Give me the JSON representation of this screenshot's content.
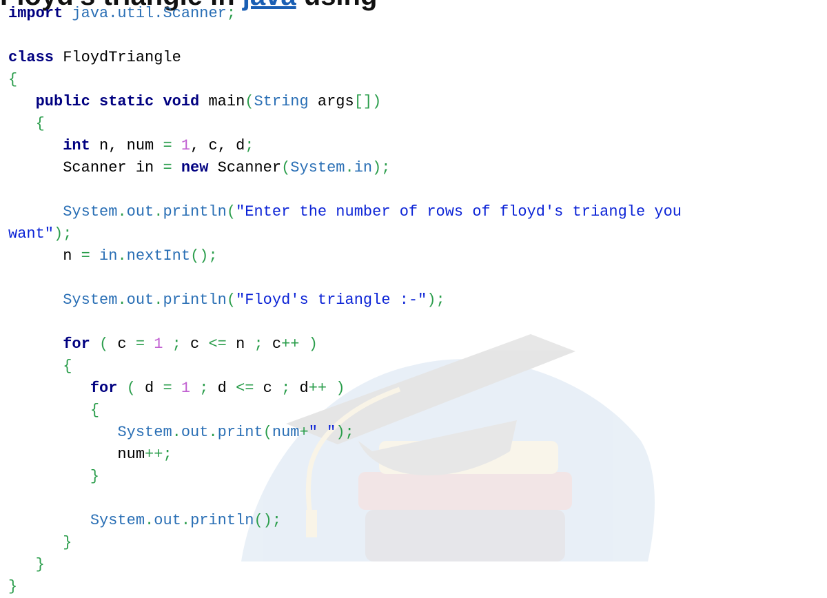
{
  "title_fragment": {
    "left_text": "Floyd's triangle in ",
    "link_text": "java",
    "right_text": " using"
  },
  "code_lines": [
    [
      {
        "t": "import",
        "c": "kw"
      },
      {
        "t": " ",
        "c": "id"
      },
      {
        "t": "java.util.Scanner",
        "c": "pk"
      },
      {
        "t": ";",
        "c": "op"
      }
    ],
    [],
    [
      {
        "t": "class",
        "c": "kw"
      },
      {
        "t": " FloydTriangle",
        "c": "id"
      }
    ],
    [
      {
        "t": "{",
        "c": "op"
      }
    ],
    [
      {
        "t": "   ",
        "c": "id"
      },
      {
        "t": "public",
        "c": "kw"
      },
      {
        "t": " ",
        "c": "id"
      },
      {
        "t": "static",
        "c": "kw"
      },
      {
        "t": " ",
        "c": "id"
      },
      {
        "t": "void",
        "c": "kw"
      },
      {
        "t": " main",
        "c": "id"
      },
      {
        "t": "(",
        "c": "op"
      },
      {
        "t": "String",
        "c": "pk"
      },
      {
        "t": " args",
        "c": "id"
      },
      {
        "t": "[])",
        "c": "op"
      }
    ],
    [
      {
        "t": "   ",
        "c": "id"
      },
      {
        "t": "{",
        "c": "op"
      }
    ],
    [
      {
        "t": "      ",
        "c": "id"
      },
      {
        "t": "int",
        "c": "kw"
      },
      {
        "t": " n, num ",
        "c": "id"
      },
      {
        "t": "=",
        "c": "op"
      },
      {
        "t": " ",
        "c": "id"
      },
      {
        "t": "1",
        "c": "num"
      },
      {
        "t": ", c, d",
        "c": "id"
      },
      {
        "t": ";",
        "c": "op"
      }
    ],
    [
      {
        "t": "      Scanner in ",
        "c": "id"
      },
      {
        "t": "=",
        "c": "op"
      },
      {
        "t": " ",
        "c": "id"
      },
      {
        "t": "new",
        "c": "kw"
      },
      {
        "t": " Scanner",
        "c": "id"
      },
      {
        "t": "(",
        "c": "op"
      },
      {
        "t": "System",
        "c": "fn"
      },
      {
        "t": ".",
        "c": "op"
      },
      {
        "t": "in",
        "c": "fn"
      },
      {
        "t": ");",
        "c": "op"
      }
    ],
    [],
    [
      {
        "t": "      ",
        "c": "id"
      },
      {
        "t": "System",
        "c": "fn"
      },
      {
        "t": ".",
        "c": "op"
      },
      {
        "t": "out",
        "c": "fn"
      },
      {
        "t": ".",
        "c": "op"
      },
      {
        "t": "println",
        "c": "fn"
      },
      {
        "t": "(",
        "c": "op"
      },
      {
        "t": "\"Enter the number of rows of floyd's triangle you",
        "c": "str"
      }
    ],
    [
      {
        "t": "want\"",
        "c": "str"
      },
      {
        "t": ");",
        "c": "op"
      }
    ],
    [
      {
        "t": "      n ",
        "c": "id"
      },
      {
        "t": "=",
        "c": "op"
      },
      {
        "t": " ",
        "c": "id"
      },
      {
        "t": "in",
        "c": "fn"
      },
      {
        "t": ".",
        "c": "op"
      },
      {
        "t": "nextInt",
        "c": "fn"
      },
      {
        "t": "();",
        "c": "op"
      }
    ],
    [],
    [
      {
        "t": "      ",
        "c": "id"
      },
      {
        "t": "System",
        "c": "fn"
      },
      {
        "t": ".",
        "c": "op"
      },
      {
        "t": "out",
        "c": "fn"
      },
      {
        "t": ".",
        "c": "op"
      },
      {
        "t": "println",
        "c": "fn"
      },
      {
        "t": "(",
        "c": "op"
      },
      {
        "t": "\"Floyd's triangle :-\"",
        "c": "str"
      },
      {
        "t": ");",
        "c": "op"
      }
    ],
    [],
    [
      {
        "t": "      ",
        "c": "id"
      },
      {
        "t": "for",
        "c": "kw"
      },
      {
        "t": " ",
        "c": "id"
      },
      {
        "t": "(",
        "c": "op"
      },
      {
        "t": " c ",
        "c": "id"
      },
      {
        "t": "=",
        "c": "op"
      },
      {
        "t": " ",
        "c": "id"
      },
      {
        "t": "1",
        "c": "num"
      },
      {
        "t": " ",
        "c": "id"
      },
      {
        "t": ";",
        "c": "op"
      },
      {
        "t": " c ",
        "c": "id"
      },
      {
        "t": "<=",
        "c": "op"
      },
      {
        "t": " n ",
        "c": "id"
      },
      {
        "t": ";",
        "c": "op"
      },
      {
        "t": " c",
        "c": "id"
      },
      {
        "t": "++",
        "c": "op"
      },
      {
        "t": " ",
        "c": "id"
      },
      {
        "t": ")",
        "c": "op"
      }
    ],
    [
      {
        "t": "      ",
        "c": "id"
      },
      {
        "t": "{",
        "c": "op"
      }
    ],
    [
      {
        "t": "         ",
        "c": "id"
      },
      {
        "t": "for",
        "c": "kw"
      },
      {
        "t": " ",
        "c": "id"
      },
      {
        "t": "(",
        "c": "op"
      },
      {
        "t": " d ",
        "c": "id"
      },
      {
        "t": "=",
        "c": "op"
      },
      {
        "t": " ",
        "c": "id"
      },
      {
        "t": "1",
        "c": "num"
      },
      {
        "t": " ",
        "c": "id"
      },
      {
        "t": ";",
        "c": "op"
      },
      {
        "t": " d ",
        "c": "id"
      },
      {
        "t": "<=",
        "c": "op"
      },
      {
        "t": " c ",
        "c": "id"
      },
      {
        "t": ";",
        "c": "op"
      },
      {
        "t": " d",
        "c": "id"
      },
      {
        "t": "++",
        "c": "op"
      },
      {
        "t": " ",
        "c": "id"
      },
      {
        "t": ")",
        "c": "op"
      }
    ],
    [
      {
        "t": "         ",
        "c": "id"
      },
      {
        "t": "{",
        "c": "op"
      }
    ],
    [
      {
        "t": "            ",
        "c": "id"
      },
      {
        "t": "System",
        "c": "fn"
      },
      {
        "t": ".",
        "c": "op"
      },
      {
        "t": "out",
        "c": "fn"
      },
      {
        "t": ".",
        "c": "op"
      },
      {
        "t": "print",
        "c": "fn"
      },
      {
        "t": "(",
        "c": "op"
      },
      {
        "t": "num",
        "c": "fn"
      },
      {
        "t": "+",
        "c": "op"
      },
      {
        "t": "\" \"",
        "c": "str"
      },
      {
        "t": ");",
        "c": "op"
      }
    ],
    [
      {
        "t": "            num",
        "c": "id"
      },
      {
        "t": "++;",
        "c": "op"
      }
    ],
    [
      {
        "t": "         ",
        "c": "id"
      },
      {
        "t": "}",
        "c": "op"
      }
    ],
    [],
    [
      {
        "t": "         ",
        "c": "id"
      },
      {
        "t": "System",
        "c": "fn"
      },
      {
        "t": ".",
        "c": "op"
      },
      {
        "t": "out",
        "c": "fn"
      },
      {
        "t": ".",
        "c": "op"
      },
      {
        "t": "println",
        "c": "fn"
      },
      {
        "t": "();",
        "c": "op"
      }
    ],
    [
      {
        "t": "      ",
        "c": "id"
      },
      {
        "t": "}",
        "c": "op"
      }
    ],
    [
      {
        "t": "   ",
        "c": "id"
      },
      {
        "t": "}",
        "c": "op"
      }
    ],
    [
      {
        "t": "}",
        "c": "op"
      }
    ]
  ]
}
